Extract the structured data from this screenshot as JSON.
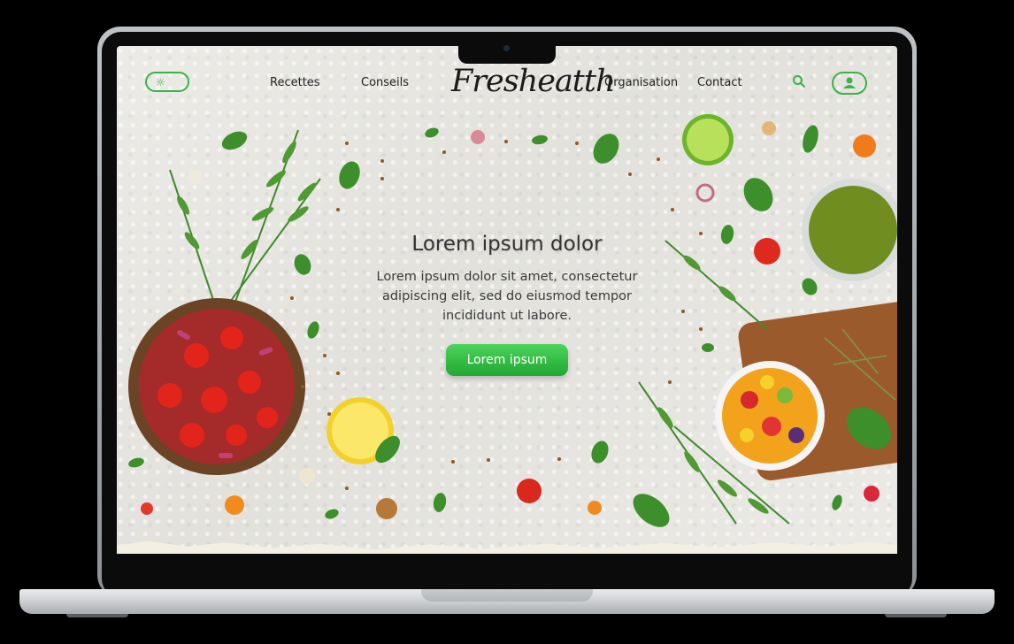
{
  "nav": {
    "left_links": [
      "Recettes",
      "Conseils"
    ],
    "right_links": [
      "Organisation",
      "Contact"
    ],
    "theme_toggle_icon": "sun-icon",
    "search_icon": "search-icon",
    "account_icon": "user-icon"
  },
  "brand": {
    "logo": "Fresheatth"
  },
  "hero": {
    "title": "Lorem ipsum dolor",
    "text": "Lorem ipsum dolor sit amet, consectetur adipiscing elit, sed do eiusmod tempor incididunt ut labore.",
    "cta_label": "Lorem ipsum"
  },
  "colors": {
    "accent": "#3ab24a",
    "cta_top": "#4cd35a",
    "cta_bottom": "#21a834",
    "background": "#e8e7e2"
  }
}
